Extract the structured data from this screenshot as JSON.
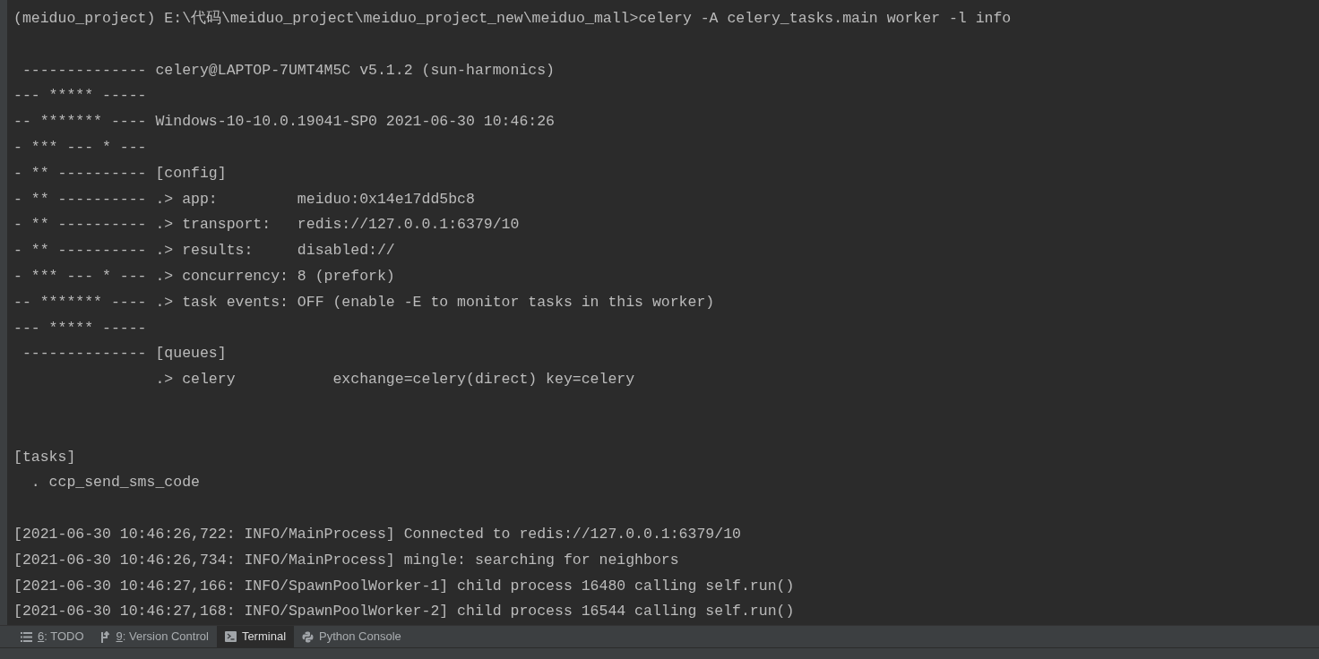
{
  "terminal": {
    "lines": [
      {
        "kind": "text",
        "text": "(meiduo_project) E:\\代码\\meiduo_project\\meiduo_project_new\\meiduo_mall>celery -A celery_tasks.main worker -l info"
      },
      {
        "kind": "blank"
      },
      {
        "kind": "text",
        "text": " -------------- celery@LAPTOP-7UMT4M5C v5.1.2 (sun-harmonics)"
      },
      {
        "kind": "text",
        "text": "--- ***** -----"
      },
      {
        "kind": "text",
        "text": "-- ******* ---- Windows-10-10.0.19041-SP0 2021-06-30 10:46:26"
      },
      {
        "kind": "text",
        "text": "- *** --- * ---"
      },
      {
        "kind": "text",
        "text": "- ** ---------- [config]"
      },
      {
        "kind": "text",
        "text": "- ** ---------- .> app:         meiduo:0x14e17dd5bc8"
      },
      {
        "kind": "text",
        "text": "- ** ---------- .> transport:   redis://127.0.0.1:6379/10"
      },
      {
        "kind": "text",
        "text": "- ** ---------- .> results:     disabled://"
      },
      {
        "kind": "text",
        "text": "- *** --- * --- .> concurrency: 8 (prefork)"
      },
      {
        "kind": "text",
        "text": "-- ******* ---- .> task events: OFF (enable -E to monitor tasks in this worker)"
      },
      {
        "kind": "text",
        "text": "--- ***** -----"
      },
      {
        "kind": "text",
        "text": " -------------- [queues]"
      },
      {
        "kind": "text",
        "text": "                .> celery           exchange=celery(direct) key=celery"
      },
      {
        "kind": "blank"
      },
      {
        "kind": "blank"
      },
      {
        "kind": "text",
        "text": "[tasks]"
      },
      {
        "kind": "text",
        "text": "  . ccp_send_sms_code"
      },
      {
        "kind": "blank"
      },
      {
        "kind": "text",
        "text": "[2021-06-30 10:46:26,722: INFO/MainProcess] Connected to redis://127.0.0.1:6379/10"
      },
      {
        "kind": "text",
        "text": "[2021-06-30 10:46:26,734: INFO/MainProcess] mingle: searching for neighbors"
      },
      {
        "kind": "text",
        "text": "[2021-06-30 10:46:27,166: INFO/SpawnPoolWorker-1] child process 16480 calling self.run()"
      },
      {
        "kind": "text",
        "text": "[2021-06-30 10:46:27,168: INFO/SpawnPoolWorker-2] child process 16544 calling self.run()"
      }
    ]
  },
  "tool_tabs": [
    {
      "kind": "list",
      "mnemonic": "6",
      "label": ": TODO",
      "selected": false
    },
    {
      "kind": "branch",
      "mnemonic": "9",
      "label": ": Version Control",
      "selected": false
    },
    {
      "kind": "terminal",
      "label": "Terminal",
      "selected": true
    },
    {
      "kind": "python",
      "label": "Python Console",
      "selected": false
    }
  ]
}
